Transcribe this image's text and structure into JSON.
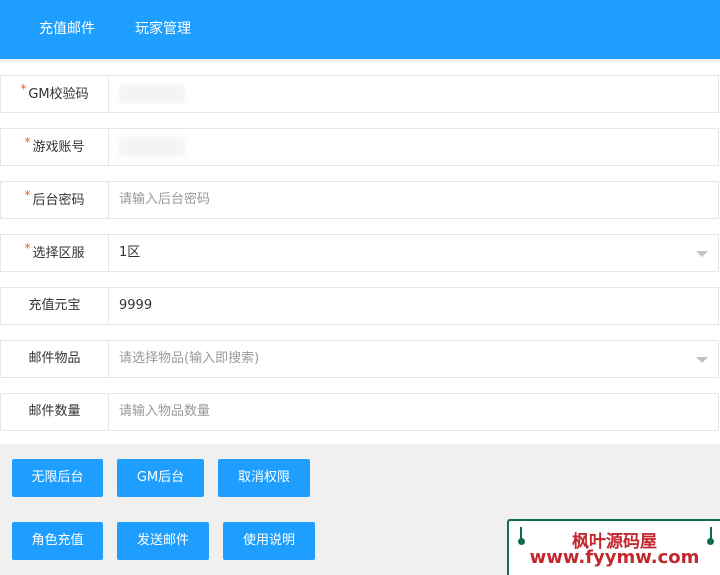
{
  "nav": {
    "tab1": "充值邮件",
    "tab2": "玩家管理"
  },
  "form": {
    "required_mark": "*",
    "gm_code": {
      "label": "GM校验码"
    },
    "account": {
      "label": "游戏账号"
    },
    "password": {
      "label": "后台密码",
      "placeholder": "请输入后台密码"
    },
    "server": {
      "label": "选择区服",
      "value": "1区"
    },
    "yuanbao": {
      "label": "充值元宝",
      "value": "9999"
    },
    "item": {
      "label": "邮件物品",
      "placeholder": "请选择物品(输入即搜索)"
    },
    "quantity": {
      "label": "邮件数量",
      "placeholder": "请输入物品数量"
    }
  },
  "buttons": {
    "unlimited": "无限后台",
    "gm": "GM后台",
    "revoke": "取消权限",
    "recharge": "角色充值",
    "send": "发送邮件",
    "help": "使用说明"
  },
  "watermark": {
    "line1": "枫叶源码屋",
    "line2": "www.fyymw.com"
  },
  "colors": {
    "primary": "#1E9FFF",
    "required": "#FF5722",
    "watermark_text": "#c1272d",
    "watermark_frame": "#0f6b4a"
  }
}
